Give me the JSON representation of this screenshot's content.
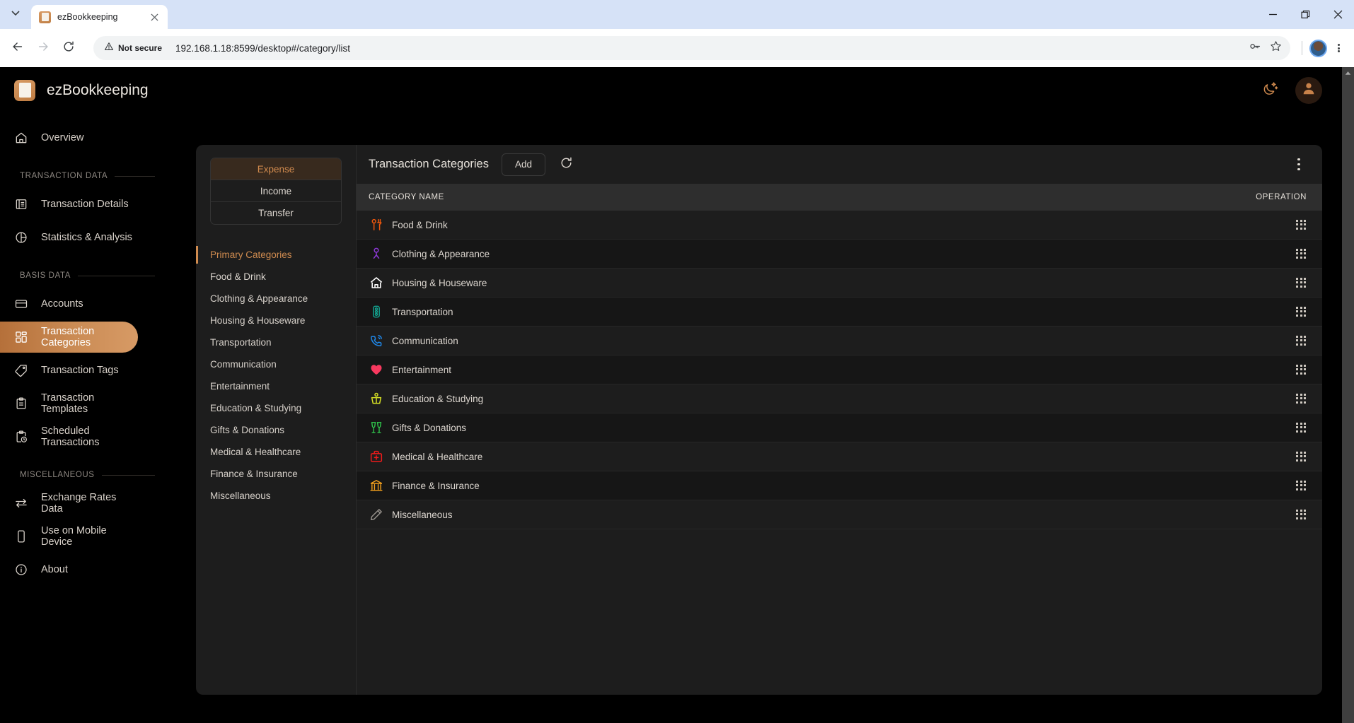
{
  "browser": {
    "tab": {
      "title": "ezBookkeeping",
      "favicon_icon": "notebook-icon",
      "close_icon": "close-icon"
    },
    "tab_list_icon": "chevron-down-icon",
    "back_icon": "arrow-left-icon",
    "forward_icon": "arrow-right-icon",
    "reload_icon": "reload-icon",
    "security_label": "Not secure",
    "security_icon": "warning-triangle-icon",
    "url": "192.168.1.18:8599/desktop#/category/list",
    "password_icon": "key-icon",
    "bookmark_icon": "star-icon",
    "profile_icon": "profile-avatar-icon",
    "menu_icon": "kebab-menu-icon",
    "minimize_icon": "minimize-icon",
    "maximize_icon": "restore-icon",
    "close_window_icon": "close-icon"
  },
  "app": {
    "brand": {
      "name": "ezBookkeeping",
      "logo_icon": "ezbookkeeping-logo-icon"
    },
    "header": {
      "theme_toggle_icon": "moon-stars-icon",
      "avatar_icon": "user-avatar-icon"
    },
    "accent_color": "#cf8b4f",
    "sidebar": {
      "top_items": [
        {
          "label": "Overview",
          "icon": "home-icon",
          "active": false
        }
      ],
      "groups": [
        {
          "title": "TRANSACTION DATA",
          "items": [
            {
              "label": "Transaction Details",
              "icon": "list-box-icon",
              "active": false
            },
            {
              "label": "Statistics & Analysis",
              "icon": "pie-chart-icon",
              "active": false
            }
          ]
        },
        {
          "title": "BASIS DATA",
          "items": [
            {
              "label": "Accounts",
              "icon": "credit-card-icon",
              "active": false
            },
            {
              "label": "Transaction Categories",
              "icon": "grid-squares-icon",
              "active": true
            },
            {
              "label": "Transaction Tags",
              "icon": "tag-icon",
              "active": false
            },
            {
              "label": "Transaction Templates",
              "icon": "clipboard-icon",
              "active": false
            },
            {
              "label": "Scheduled Transactions",
              "icon": "clipboard-clock-icon",
              "active": false
            }
          ]
        },
        {
          "title": "MISCELLANEOUS",
          "items": [
            {
              "label": "Exchange Rates Data",
              "icon": "exchange-arrows-icon",
              "active": false
            },
            {
              "label": "Use on Mobile Device",
              "icon": "mobile-phone-icon",
              "active": false
            },
            {
              "label": "About",
              "icon": "info-circle-icon",
              "active": false
            }
          ]
        }
      ]
    },
    "category_panel": {
      "type_tabs": [
        {
          "label": "Expense",
          "active": true
        },
        {
          "label": "Income",
          "active": false
        },
        {
          "label": "Transfer",
          "active": false
        }
      ],
      "items": [
        {
          "label": "Primary Categories",
          "active": true
        },
        {
          "label": "Food & Drink",
          "active": false
        },
        {
          "label": "Clothing & Appearance",
          "active": false
        },
        {
          "label": "Housing & Houseware",
          "active": false
        },
        {
          "label": "Transportation",
          "active": false
        },
        {
          "label": "Communication",
          "active": false
        },
        {
          "label": "Entertainment",
          "active": false
        },
        {
          "label": "Education & Studying",
          "active": false
        },
        {
          "label": "Gifts & Donations",
          "active": false
        },
        {
          "label": "Medical & Healthcare",
          "active": false
        },
        {
          "label": "Finance & Insurance",
          "active": false
        },
        {
          "label": "Miscellaneous",
          "active": false
        }
      ]
    },
    "main": {
      "title": "Transaction Categories",
      "add_label": "Add",
      "refresh_icon": "refresh-icon",
      "more_icon": "vertical-dots-icon",
      "columns": {
        "name": "CATEGORY NAME",
        "operation": "OPERATION"
      },
      "rows": [
        {
          "name": "Food & Drink",
          "icon": "fork-spoon-icon",
          "color": "#f0570c"
        },
        {
          "name": "Clothing & Appearance",
          "icon": "person-icon",
          "color": "#8b38d4"
        },
        {
          "name": "Housing & Houseware",
          "icon": "house-icon",
          "color": "#ffffff"
        },
        {
          "name": "Transportation",
          "icon": "traffic-light-icon",
          "color": "#13a894"
        },
        {
          "name": "Communication",
          "icon": "phone-ring-icon",
          "color": "#1f87e8"
        },
        {
          "name": "Entertainment",
          "icon": "heart-icon",
          "color": "#f8395f"
        },
        {
          "name": "Education & Studying",
          "icon": "graduation-cap-icon",
          "color": "#d6e024"
        },
        {
          "name": "Gifts & Donations",
          "icon": "champagne-glasses-icon",
          "color": "#2fc04a"
        },
        {
          "name": "Medical & Healthcare",
          "icon": "first-aid-kit-icon",
          "color": "#f01b1b"
        },
        {
          "name": "Finance & Insurance",
          "icon": "bank-icon",
          "color": "#f5a11c"
        },
        {
          "name": "Miscellaneous",
          "icon": "pencil-icon",
          "color": "#9a958f"
        }
      ],
      "drag_handle_icon": "drag-grid-icon"
    },
    "scrollbar": {
      "arrow_up_icon": "caret-up-icon"
    }
  }
}
